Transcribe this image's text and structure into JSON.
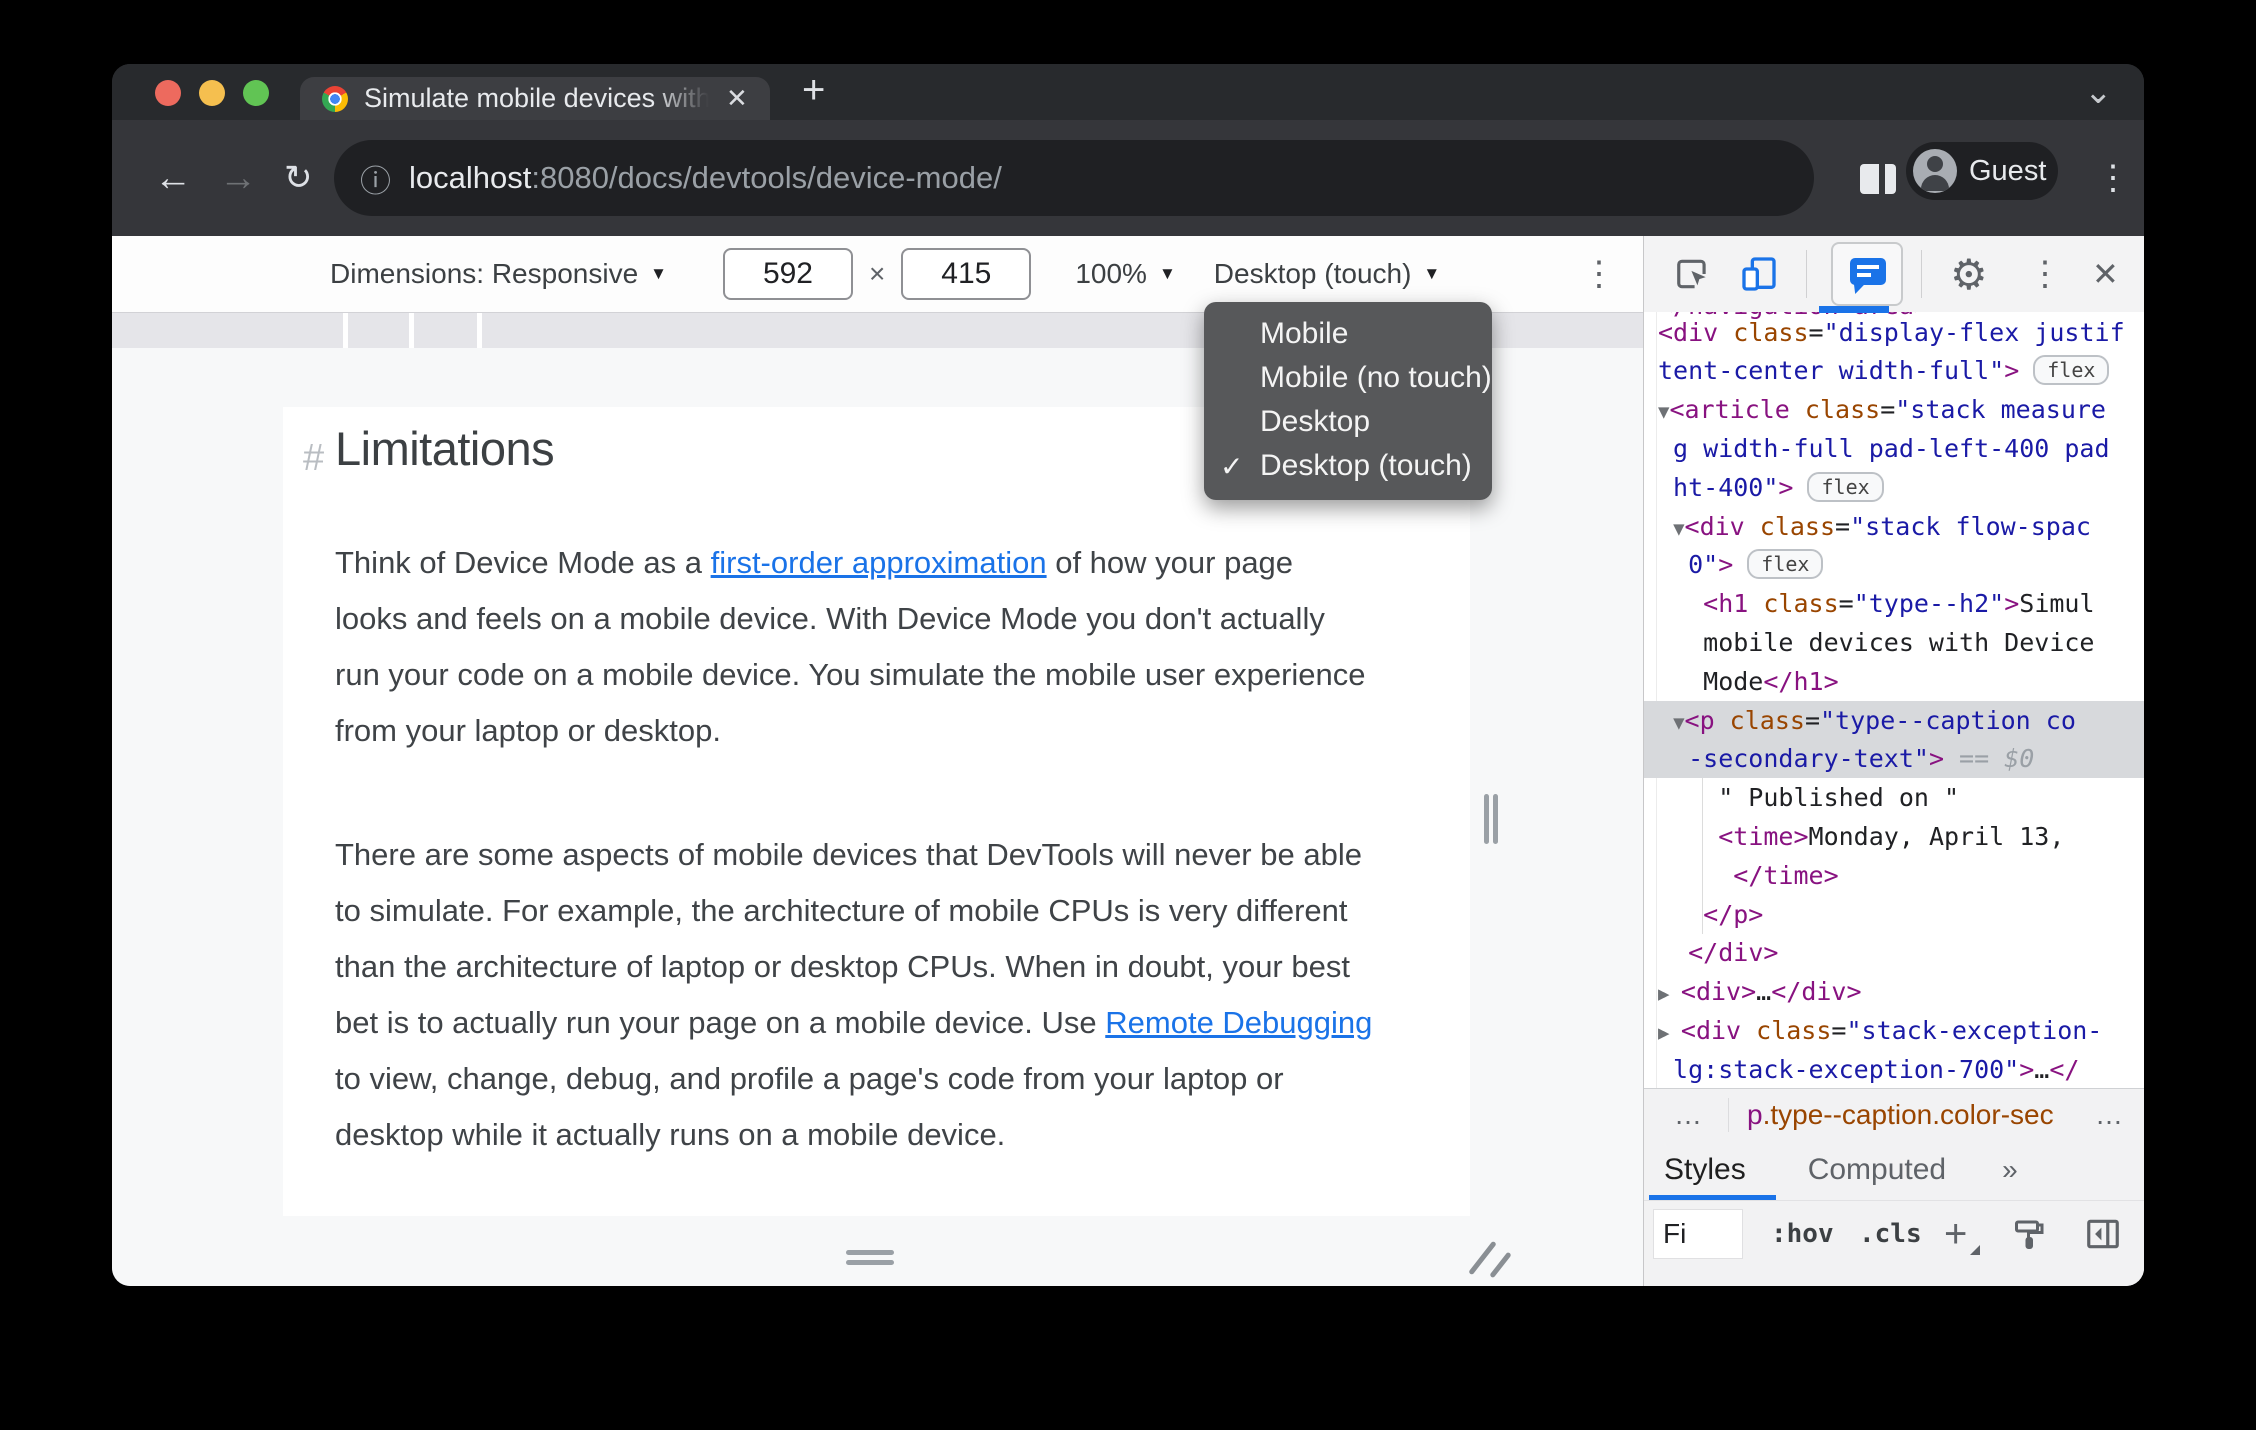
{
  "browser": {
    "traffic_lights": {
      "close_color": "#ed6a5e",
      "minimize_color": "#f5bf4f",
      "zoom_color": "#61c454"
    },
    "tab": {
      "title": "Simulate mobile devices with D",
      "close_glyph": "✕"
    },
    "new_tab_glyph": "+",
    "strip_chevron_glyph": "⌄",
    "toolbar": {
      "back_glyph": "←",
      "forward_glyph": "→",
      "reload_glyph": "↻",
      "info_glyph": "ⓘ",
      "url_host": "localhost",
      "url_path": ":8080/docs/devtools/device-mode/",
      "profile_label": "Guest",
      "more_glyph": "⋮"
    }
  },
  "device_toolbar": {
    "dimensions_label": "Dimensions: Responsive",
    "caret_glyph": "▼",
    "width_value": "592",
    "multiply_glyph": "×",
    "height_value": "415",
    "zoom_value": "100%",
    "device_type_value": "Desktop (touch)",
    "more_glyph": "⋮"
  },
  "device_type_menu": {
    "check_glyph": "✓",
    "items": [
      {
        "label": "Mobile",
        "checked": false
      },
      {
        "label": "Mobile (no touch)",
        "checked": false
      },
      {
        "label": "Desktop",
        "checked": false
      },
      {
        "label": "Desktop (touch)",
        "checked": true
      }
    ]
  },
  "page": {
    "heading_hash": "#",
    "heading": "Limitations",
    "link_color": "#1a73e8",
    "paragraph1": [
      {
        "t": "Think of Device Mode as a "
      },
      {
        "t": "first-order approximation",
        "link": true
      },
      {
        "t": " of how your page\nlooks and feels on a mobile device. With Device Mode you don't actually\nrun your code on a mobile device. You simulate the mobile user experience\nfrom your laptop or desktop."
      }
    ],
    "paragraph2": [
      {
        "t": "There are some aspects of mobile devices that DevTools will never be able\nto simulate. For example, the architecture of mobile CPUs is very different\nthan the architecture of laptop or desktop CPUs. When in doubt, your best\nbet is to actually run your page on a mobile device. Use "
      },
      {
        "t": "Remote Debugging",
        "link": true
      },
      {
        "t": "\nto view, change, debug, and profile a page's code from your laptop or\ndesktop while it actually runs on a mobile device."
      }
    ]
  },
  "devtools": {
    "toolbar_icons": {
      "gear_glyph": "⚙",
      "more_glyph": "⋮",
      "close_glyph": "✕"
    },
    "code": {
      "colors": {
        "tag": "#881280",
        "attr": "#994500",
        "value": "#1a1aa6",
        "text": "#202124",
        "dim": "#9aa0a6",
        "selected_bg": "#d7d9dc"
      },
      "badge_label": "flex",
      "lines": [
        {
          "seg": [
            {
              "t": "</navigation-area>",
              "c": "tag"
            }
          ]
        },
        {
          "seg": [
            {
              "t": "<div ",
              "c": "tag"
            },
            {
              "t": "class",
              "c": "attr"
            },
            {
              "t": "=",
              "c": "txt"
            },
            {
              "t": "\"display-flex justif",
              "c": "val"
            }
          ]
        },
        {
          "badge": true,
          "seg": [
            {
              "t": "tent-center width-full\"",
              "c": "val"
            },
            {
              "t": ">",
              "c": "tag"
            }
          ]
        },
        {
          "seg": [
            {
              "t": "▼",
              "c": "arrow"
            },
            {
              "t": "<article ",
              "c": "tag"
            },
            {
              "t": "class",
              "c": "attr"
            },
            {
              "t": "=",
              "c": "txt"
            },
            {
              "t": "\"stack measure",
              "c": "val"
            }
          ]
        },
        {
          "seg": [
            {
              "t": " g width-full pad-left-400 pad",
              "c": "val"
            }
          ]
        },
        {
          "badge": true,
          "seg": [
            {
              "t": " ht-400\"",
              "c": "val"
            },
            {
              "t": ">",
              "c": "tag"
            }
          ]
        },
        {
          "seg": [
            {
              "t": " ",
              "c": "txt"
            },
            {
              "t": "▼",
              "c": "arrow"
            },
            {
              "t": "<div ",
              "c": "tag"
            },
            {
              "t": "class",
              "c": "attr"
            },
            {
              "t": "=",
              "c": "txt"
            },
            {
              "t": "\"stack flow-spac",
              "c": "val"
            }
          ]
        },
        {
          "badge": true,
          "seg": [
            {
              "t": "  0\"",
              "c": "val"
            },
            {
              "t": ">",
              "c": "tag"
            }
          ]
        },
        {
          "seg": [
            {
              "t": "   ",
              "c": "txt"
            },
            {
              "t": "<h1 ",
              "c": "tag"
            },
            {
              "t": "class",
              "c": "attr"
            },
            {
              "t": "=",
              "c": "txt"
            },
            {
              "t": "\"type--h2\"",
              "c": "val"
            },
            {
              "t": ">",
              "c": "tag"
            },
            {
              "t": "Simul",
              "c": "txt"
            }
          ]
        },
        {
          "seg": [
            {
              "t": "   mobile devices with Device",
              "c": "txt"
            }
          ]
        },
        {
          "seg": [
            {
              "t": "   Mode",
              "c": "txt"
            },
            {
              "t": "</h1>",
              "c": "tag"
            }
          ]
        },
        {
          "hl": true,
          "seg": [
            {
              "t": " ",
              "c": "txt"
            },
            {
              "t": "▼",
              "c": "arrow"
            },
            {
              "t": "<p ",
              "c": "tag"
            },
            {
              "t": "class",
              "c": "attr"
            },
            {
              "t": "=",
              "c": "txt"
            },
            {
              "t": "\"type--caption co",
              "c": "val"
            }
          ]
        },
        {
          "hl": true,
          "seg": [
            {
              "t": "  -secondary-text\"",
              "c": "val"
            },
            {
              "t": ">",
              "c": "tag"
            },
            {
              "t": " == ",
              "c": "dim"
            },
            {
              "t": "$0",
              "c": "dollar"
            }
          ]
        },
        {
          "seg": [
            {
              "t": "    \" Published on \"",
              "c": "txt"
            }
          ]
        },
        {
          "seg": [
            {
              "t": "    ",
              "c": "txt"
            },
            {
              "t": "<time>",
              "c": "tag"
            },
            {
              "t": "Monday, April 13,",
              "c": "txt"
            }
          ]
        },
        {
          "seg": [
            {
              "t": "     ",
              "c": "txt"
            },
            {
              "t": "</time>",
              "c": "tag"
            }
          ]
        },
        {
          "seg": [
            {
              "t": "   ",
              "c": "txt"
            },
            {
              "t": "</p>",
              "c": "tag"
            }
          ]
        },
        {
          "seg": [
            {
              "t": "  ",
              "c": "txt"
            },
            {
              "t": "</div>",
              "c": "tag"
            }
          ]
        },
        {
          "seg": [
            {
              "t": "▶ ",
              "c": "arrow"
            },
            {
              "t": "<div>",
              "c": "tag"
            },
            {
              "t": "…",
              "c": "txt"
            },
            {
              "t": "</div>",
              "c": "tag"
            }
          ]
        },
        {
          "seg": [
            {
              "t": "▶ ",
              "c": "arrow"
            },
            {
              "t": "<div ",
              "c": "tag"
            },
            {
              "t": "class",
              "c": "attr"
            },
            {
              "t": "=",
              "c": "txt"
            },
            {
              "t": "\"stack-exception-",
              "c": "val"
            }
          ]
        },
        {
          "seg": [
            {
              "t": " lg:stack-exception-700\"",
              "c": "val"
            },
            {
              "t": ">",
              "c": "tag"
            },
            {
              "t": "…",
              "c": "txt"
            },
            {
              "t": "</",
              "c": "tag"
            }
          ]
        }
      ]
    },
    "breadcrumb": {
      "ellipsis_left": "…",
      "selected_tag": "p",
      "selected_classes": ".type--caption.color-sec",
      "ellipsis_right": "…"
    },
    "sidebar_tabs": {
      "active_tab": "Styles",
      "tab2": "Computed",
      "overflow_glyph": "»"
    },
    "filter_bar": {
      "filter_value": "Fi",
      "hov_label": ":hov",
      "cls_label": ".cls",
      "plus_glyph": "+"
    }
  }
}
